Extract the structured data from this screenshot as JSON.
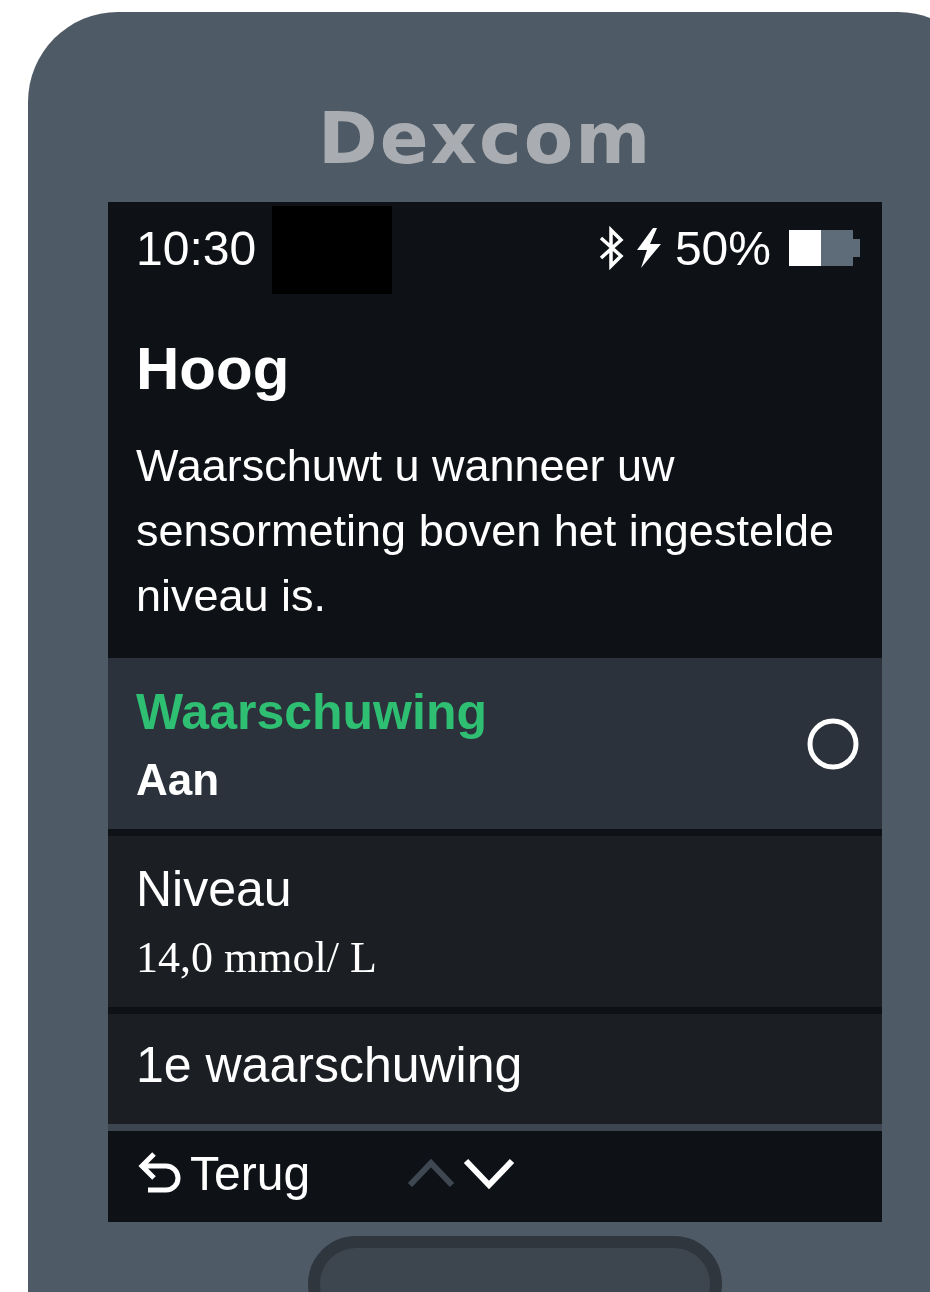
{
  "device": {
    "logo": "Dexcom"
  },
  "status_bar": {
    "time": "10:30",
    "battery_text": "50%",
    "battery": {
      "level": 0.5
    }
  },
  "header": {
    "title": "Hoog",
    "description": "Waarschuwt u wanneer uw sensormeting boven het ingestelde niveau is."
  },
  "items": [
    {
      "kind": "toggle",
      "label": "Waarschuwing",
      "value": "Aan",
      "selected": true
    },
    {
      "kind": "value",
      "label": "Niveau",
      "value": "14,0 mmol/ L",
      "selected": false
    },
    {
      "kind": "value",
      "label": "1e waarschuwing",
      "selected": false
    }
  ],
  "bottom_bar": {
    "back": "Terug"
  }
}
